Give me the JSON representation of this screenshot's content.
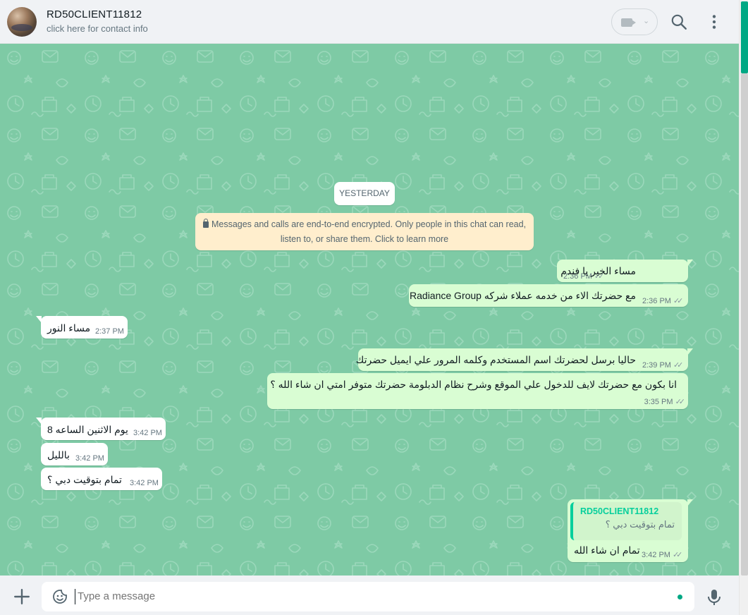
{
  "header": {
    "contact_name": "RD50CLIENT11812",
    "contact_subtitle": "click here for contact info"
  },
  "chat": {
    "date_chip": "YESTERDAY",
    "encryption_notice_line1": "Messages and calls are end-to-end encrypted. Only people in this chat can read,",
    "encryption_notice_line2": "listen to, or share them. Click to learn more",
    "messages": [
      {
        "dir": "out",
        "text": "مساء الخير يا فندم",
        "time": "2:36 PM"
      },
      {
        "dir": "out",
        "text": "مع حضرتك الاء من خدمه عملاء شركه Radiance Group",
        "time": "2:36 PM"
      },
      {
        "dir": "in",
        "text": "مساء النور",
        "time": "2:37 PM"
      },
      {
        "dir": "out",
        "text": "حاليا برسل لحضرتك اسم المستخدم وكلمه المرور علي ايميل حضرتك",
        "time": "2:39 PM"
      },
      {
        "dir": "out",
        "text": "انا بكون مع حضرتك لايف للدخول علي الموقع وشرح نظام الدبلومة حضرتك متوفر امتي ان شاء الله ؟",
        "time": "3:35 PM"
      },
      {
        "dir": "in",
        "text": "يوم الاثنين الساعه 8",
        "time": "3:42 PM"
      },
      {
        "dir": "in",
        "text": "بالليل",
        "time": "3:42 PM"
      },
      {
        "dir": "in",
        "text": "تمام بتوقيت دبي ؟",
        "time": "3:42 PM"
      },
      {
        "dir": "out",
        "text": "تمام ان شاء الله",
        "time": "3:42 PM",
        "quote_name": "RD50CLIENT11812",
        "quote_text": "تمام بتوقيت دبي ؟"
      }
    ]
  },
  "footer": {
    "placeholder": "Type a message"
  },
  "icons": {
    "video": "video-camera-icon",
    "search": "search-icon",
    "menu": "kebab-menu-icon",
    "plus": "plus-icon",
    "emoji": "sticker-emoji-icon",
    "mic": "microphone-icon",
    "lock": "lock-icon",
    "tick": "double-check-icon"
  },
  "colors": {
    "chat_bg": "#7ecaa5",
    "outgoing_bubble": "#d9fdd3",
    "incoming_bubble": "#ffffff",
    "accent": "#00a884",
    "encryption_bg": "#ffeecd"
  }
}
